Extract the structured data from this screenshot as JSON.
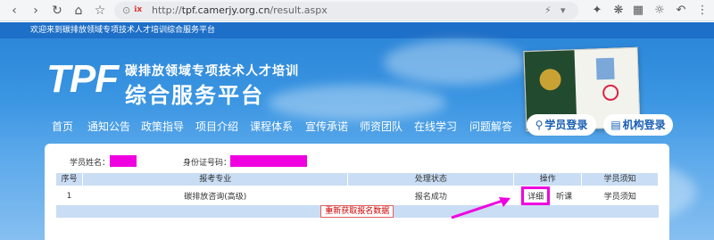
{
  "browser": {
    "url_host": "tpf.camerjy.org.cn",
    "url_path": "/result.aspx",
    "url_scheme": "http://"
  },
  "site": {
    "welcome": "欢迎来到碳排放领域专项技术人才培训综合服务平台",
    "logo_text": "TPF",
    "title_line1": "碳排放领域专项技术人才培训",
    "title_line2": "综合服务平台",
    "nav": [
      "首页",
      "通知公告",
      "政策指导",
      "项目介绍",
      "课程体系",
      "宣传承诺",
      "师资团队",
      "在线学习",
      "问题解答"
    ],
    "student_login": "学员登录",
    "org_login": "机构登录"
  },
  "result": {
    "name_label": "学员姓名：",
    "id_label": "身份证号码：",
    "columns": [
      "序号",
      "报考专业",
      "处理状态",
      "操作",
      "学员须知"
    ],
    "rows": [
      {
        "no": "1",
        "major": "碳排放咨询(高级)",
        "status": "报名成功",
        "detail": "详细",
        "listen": "听课",
        "notice": "学员须知"
      }
    ],
    "refresh_label": "重新获取报名数据"
  },
  "colors": {
    "header_blue": "#2a83d6",
    "highlight_magenta": "#f000e0",
    "table_header": "#c9ddf4"
  }
}
